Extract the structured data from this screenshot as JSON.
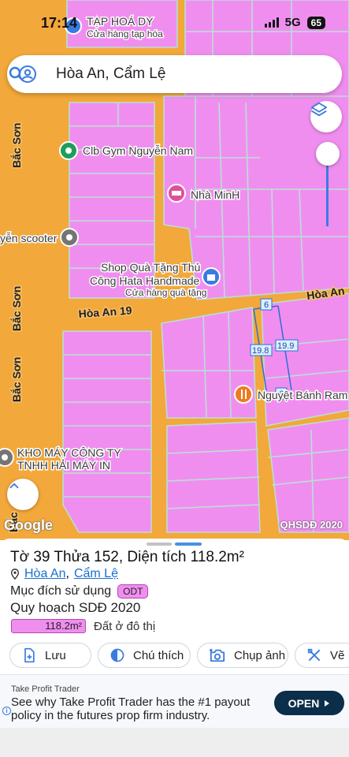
{
  "status_bar": {
    "time": "17:14",
    "network": "5G",
    "battery": "65"
  },
  "search": {
    "query": "Hòa An, Cẩm Lệ"
  },
  "map": {
    "roads": {
      "bac_son_1": "Bắc Sơn",
      "bac_son_2": "Bắc Sơn",
      "bac_son_3": "Bắc Sơn",
      "hoa_an_19": "Hòa An 19",
      "hoa_an_right": "Hòa An",
      "bottom_left_road": "Bắc"
    },
    "pois": {
      "taphoa_name": "TẠP HOÁ DY",
      "taphoa_sub": "Cửa hàng tạp hóa",
      "gym": "Clb Gym Nguyễn Nam",
      "nha_minh": "Nhà MinH",
      "scooter": "yễn scooter",
      "shop_line1": "Shop Quà Tặng Thủ",
      "shop_line2": "Công Hata Handmade",
      "shop_sub": "Cửa hàng quà tặng",
      "nguyet": "Nguyệt Bánh Ram",
      "kho_line1": "KHO MÁY CÔNG TY",
      "kho_line2": "TNHH HẢI MÁY IN"
    },
    "dimensions": {
      "top": "6",
      "left": "19.8",
      "right": "19.9",
      "bottom": "6"
    },
    "logo": "Google",
    "source": "QHSDĐ 2020"
  },
  "parcel": {
    "title": "Tờ 39 Thửa 152, Diện tích 118.2m²",
    "ward": "Hòa An",
    "separator": ",",
    "district": "Cẩm Lệ",
    "purpose_label": "Mục đích sử dụng",
    "purpose_code": "ODT",
    "plan_label": "Quy hoạch SDĐ 2020",
    "legend_area": "118.2m²",
    "legend_text": "Đất ở đô thị"
  },
  "actions": {
    "save": "Lưu",
    "legend": "Chú thích",
    "photo": "Chụp ảnh",
    "draw": "Vẽ"
  },
  "ad": {
    "brand": "Take Profit Trader",
    "text": "See why Take Profit Trader has the #1 payout policy in the futures prop firm industry.",
    "cta": "OPEN"
  },
  "colors": {
    "road": "#f2a83a",
    "land": "#f08ef0",
    "accent": "#1a6fd0",
    "ad_button": "#0b2e4a"
  }
}
